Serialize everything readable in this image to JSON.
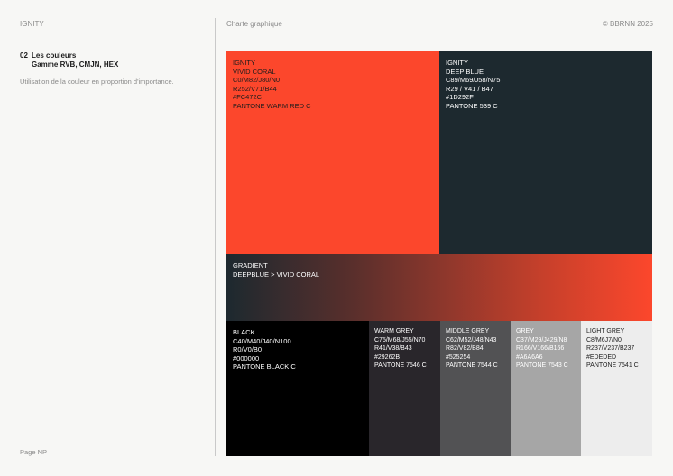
{
  "header": {
    "brand": "IGNITY",
    "doc_title": "Charte graphique",
    "copyright": "© BBRNN 2025"
  },
  "section": {
    "number": "02",
    "title_line1": "Les couleurs",
    "title_line2": "Gamme RVB, CMJN, HEX",
    "description": "Utilisation de la couleur en proportion d'importance."
  },
  "footer": {
    "page": "Page NP"
  },
  "swatches": {
    "coral": {
      "lines": [
        "IGNITY",
        "VIVID CORAL",
        "C0/M82/J80/N0",
        "R252/V71/B44",
        "#FC472C",
        "PANTONE WARM RED C"
      ],
      "color": "#FC472C"
    },
    "blue": {
      "lines": [
        "IGNITY",
        "DEEP BLUE",
        "C89/M69/J58/N75",
        "R29 / V41 / B47",
        "#1D292F",
        "PANTONE 539 C"
      ],
      "color": "#1D292F"
    },
    "gradient": {
      "lines": [
        "GRADIENT",
        "DEEPBLUE > VIVID CORAL"
      ]
    },
    "black": {
      "lines": [
        "BLACK",
        "C40/M40/J40/N100",
        "R0/V0/B0",
        "#000000",
        "PANTONE BLACK C"
      ],
      "color": "#000000"
    },
    "warm_grey": {
      "lines": [
        "WARM GREY",
        "C75/M68/J55/N70",
        "R41/V38/B43",
        "#29262B",
        "PANTONE 7546 C"
      ],
      "color": "#29262B"
    },
    "middle_grey": {
      "lines": [
        "MIDDLE GREY",
        "C62/M52/J48/N43",
        "R82/V82/B84",
        "#525254",
        "PANTONE 7544 C"
      ],
      "color": "#525254"
    },
    "grey": {
      "lines": [
        "GREY",
        "C37/M29/J429/N8",
        "R166/V166/B166",
        "#A6A6A6",
        "PANTONE 7543 C"
      ],
      "color": "#A6A6A6"
    },
    "light_grey": {
      "lines": [
        "LIGHT GREY",
        "C8/M6J7/N0",
        "R237/V237/B237",
        "#EDEDED",
        "PANTONE 7541 C"
      ],
      "color": "#EDEDED"
    }
  }
}
